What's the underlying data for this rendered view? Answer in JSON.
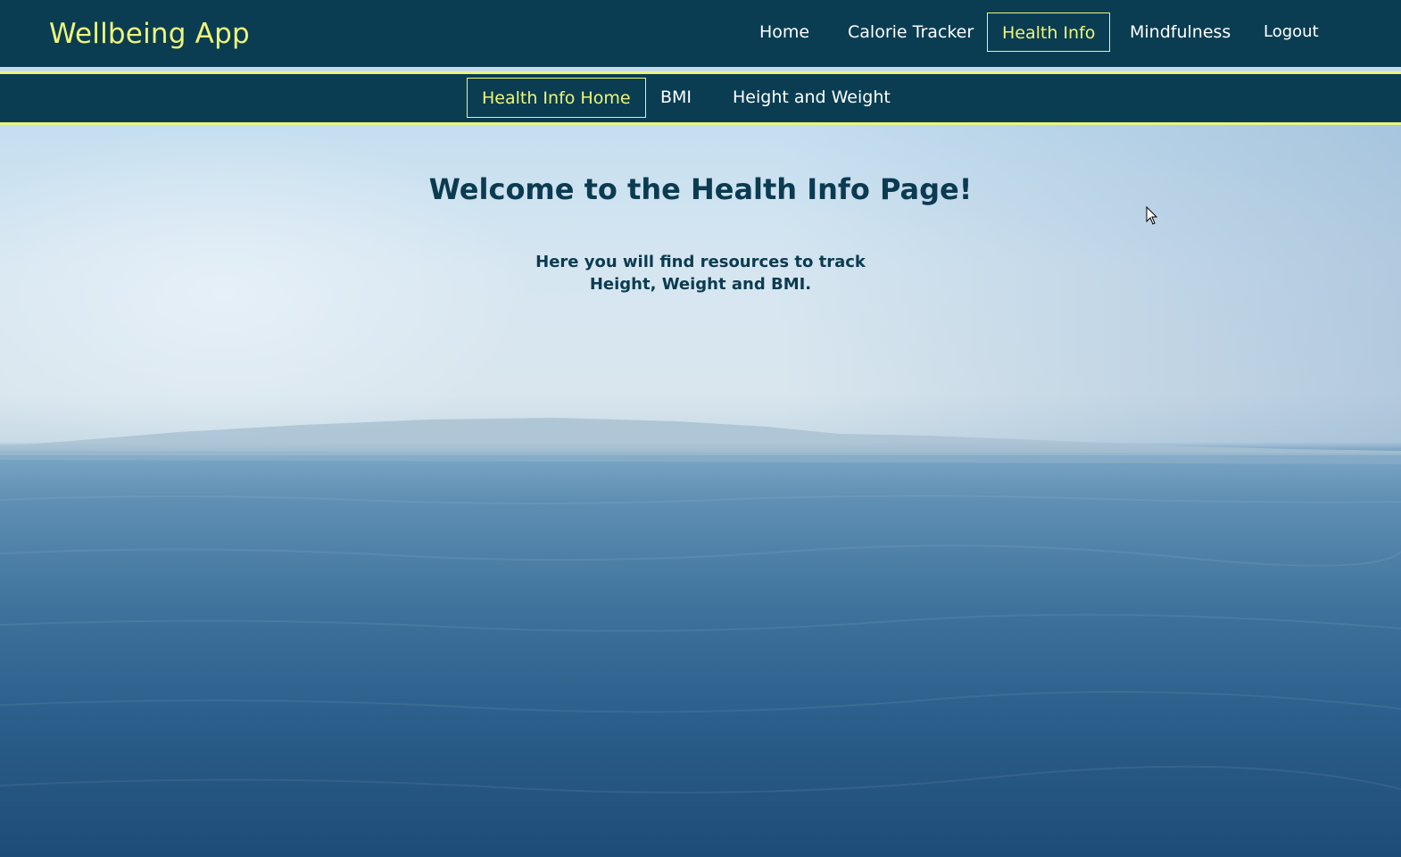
{
  "app": {
    "brand": "Wellbeing App"
  },
  "nav": {
    "items": [
      {
        "label": "Home"
      },
      {
        "label": "Calorie Tracker"
      },
      {
        "label": "Health Info"
      },
      {
        "label": "Mindfulness"
      },
      {
        "label": "Logout"
      }
    ],
    "active": "Health Info"
  },
  "subnav": {
    "items": [
      {
        "label": "Health Info Home"
      },
      {
        "label": "BMI"
      },
      {
        "label": "Height and Weight"
      }
    ],
    "active": "Health Info Home"
  },
  "main": {
    "title": "Welcome to the Health Info Page!",
    "description": "Here you will find resources to track Height, Weight and BMI."
  },
  "colors": {
    "navbar_bg": "#0a3d52",
    "accent_yellow": "#eef57a",
    "heading_text": "#0b3b50"
  }
}
